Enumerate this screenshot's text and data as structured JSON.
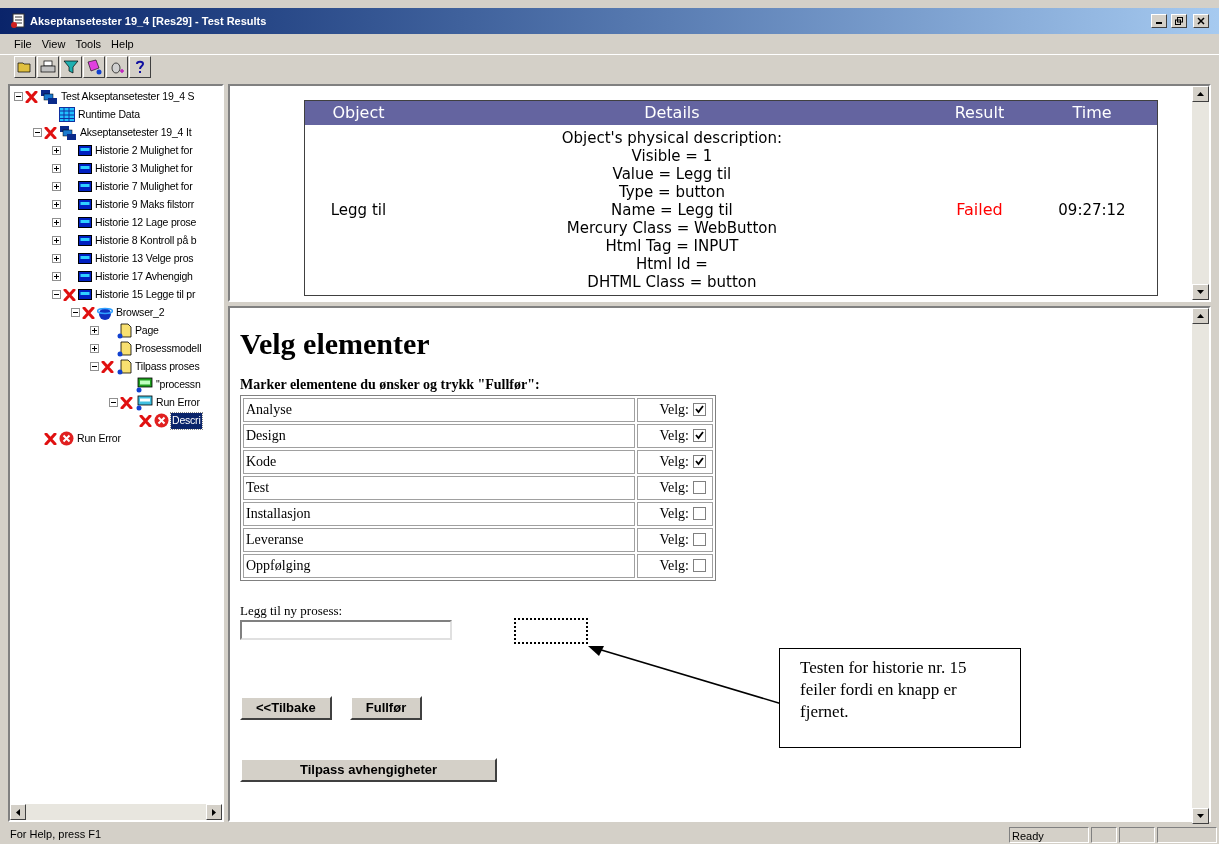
{
  "window": {
    "title": "Akseptansetester 19_4 [Res29] - Test Results"
  },
  "menu": [
    "File",
    "View",
    "Tools",
    "Help"
  ],
  "tree": [
    {
      "label": "Test Akseptansetester 19_4 S",
      "kind": "test",
      "failed": true,
      "expanded": true,
      "selected": false,
      "children": [
        {
          "label": "Runtime Data",
          "kind": "grid",
          "failed": false,
          "selected": false
        },
        {
          "label": "Akseptansetester 19_4 It",
          "kind": "iteration",
          "failed": true,
          "expanded": true,
          "selected": false,
          "children": [
            {
              "label": "Historie 2 Mulighet for",
              "kind": "action",
              "failed": false,
              "expanded": false,
              "selected": false
            },
            {
              "label": "Historie 3 Mulighet for",
              "kind": "action",
              "failed": false,
              "expanded": false,
              "selected": false
            },
            {
              "label": "Historie 7 Mulighet for",
              "kind": "action",
              "failed": false,
              "expanded": false,
              "selected": false
            },
            {
              "label": "Historie 9 Maks filstorr",
              "kind": "action",
              "failed": false,
              "expanded": false,
              "selected": false
            },
            {
              "label": "Historie 12 Lage prose",
              "kind": "action",
              "failed": false,
              "expanded": false,
              "selected": false
            },
            {
              "label": "Historie 8 Kontroll på b",
              "kind": "action",
              "failed": false,
              "expanded": false,
              "selected": false
            },
            {
              "label": "Historie 13 Velge pros",
              "kind": "action",
              "failed": false,
              "expanded": false,
              "selected": false
            },
            {
              "label": "Historie 17 Avhengigh",
              "kind": "action",
              "failed": false,
              "expanded": false,
              "selected": false
            },
            {
              "label": "Historie 15 Legge til pr",
              "kind": "action",
              "failed": true,
              "expanded": true,
              "selected": false,
              "children": [
                {
                  "label": "Browser_2",
                  "kind": "browser",
                  "failed": true,
                  "expanded": true,
                  "selected": false,
                  "children": [
                    {
                      "label": "Page",
                      "kind": "page",
                      "failed": false,
                      "expanded": false,
                      "selected": false
                    },
                    {
                      "label": "Prosessmodell",
                      "kind": "page",
                      "failed": false,
                      "expanded": false,
                      "selected": false
                    },
                    {
                      "label": "Tilpass proses",
                      "kind": "page",
                      "failed": true,
                      "expanded": true,
                      "selected": false,
                      "children": [
                        {
                          "label": "\"processn",
                          "kind": "editbox",
                          "failed": false,
                          "selected": false
                        },
                        {
                          "label": "Run Error",
                          "kind": "object",
                          "failed": true,
                          "expanded": true,
                          "selected": false,
                          "children": [
                            {
                              "label": "Descri",
                              "kind": "error",
                              "failed": true,
                              "selected": true
                            }
                          ]
                        }
                      ]
                    }
                  ]
                }
              ]
            }
          ]
        },
        {
          "label": "Run Error",
          "kind": "error",
          "failed": true,
          "selected": false
        }
      ]
    }
  ],
  "results": {
    "columns": [
      "Object",
      "Details",
      "Result",
      "Time"
    ],
    "rows": [
      {
        "object": "Legg til",
        "details": [
          "Object's physical description:",
          "Visible = 1",
          "Value = Legg til",
          "Type = button",
          "Name = Legg til",
          "Mercury Class = WebButton",
          "Html Tag = INPUT",
          "Html Id =",
          "DHTML Class = button"
        ],
        "result": "Failed",
        "failed": true,
        "time": "09:27:12"
      }
    ]
  },
  "page": {
    "heading": "Velg elementer",
    "instruction": "Marker elementene du ønsker og trykk \"Fullfør\":",
    "elements": [
      {
        "name": "Analyse",
        "label": "Velg:",
        "checked": true
      },
      {
        "name": "Design",
        "label": "Velg:",
        "checked": true
      },
      {
        "name": "Kode",
        "label": "Velg:",
        "checked": true
      },
      {
        "name": "Test",
        "label": "Velg:",
        "checked": false
      },
      {
        "name": "Installasjon",
        "label": "Velg:",
        "checked": false
      },
      {
        "name": "Leveranse",
        "label": "Velg:",
        "checked": false
      },
      {
        "name": "Oppfølging",
        "label": "Velg:",
        "checked": false
      }
    ],
    "new_process": {
      "label": "Legg til ny prosess:"
    },
    "nav_buttons": [
      "<<Tilbake",
      "Fullfør"
    ],
    "extra_button": "Tilpass avhengigheter",
    "callout": "Testen for historie nr. 15 feiler fordi en knapp er fjernet."
  },
  "status_bar": {
    "help": "For Help, press F1",
    "state": "Ready"
  }
}
